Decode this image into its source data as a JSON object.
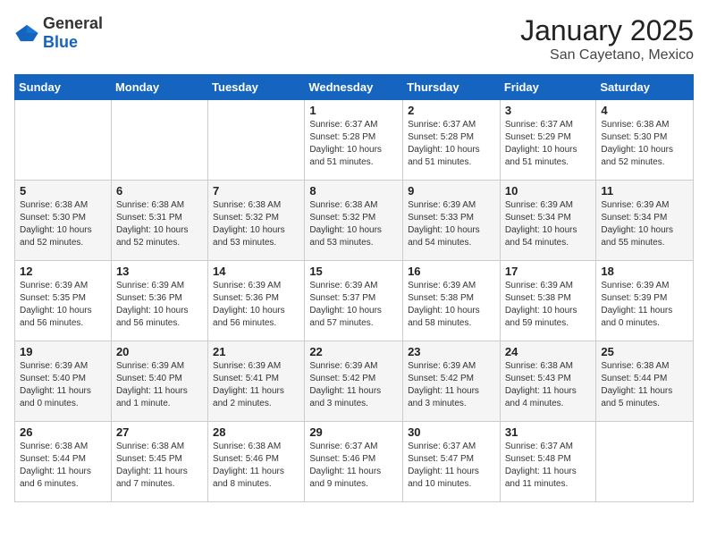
{
  "logo": {
    "general": "General",
    "blue": "Blue"
  },
  "header": {
    "month": "January 2025",
    "location": "San Cayetano, Mexico"
  },
  "weekdays": [
    "Sunday",
    "Monday",
    "Tuesday",
    "Wednesday",
    "Thursday",
    "Friday",
    "Saturday"
  ],
  "weeks": [
    [
      {
        "day": "",
        "info": ""
      },
      {
        "day": "",
        "info": ""
      },
      {
        "day": "",
        "info": ""
      },
      {
        "day": "1",
        "info": "Sunrise: 6:37 AM\nSunset: 5:28 PM\nDaylight: 10 hours\nand 51 minutes."
      },
      {
        "day": "2",
        "info": "Sunrise: 6:37 AM\nSunset: 5:28 PM\nDaylight: 10 hours\nand 51 minutes."
      },
      {
        "day": "3",
        "info": "Sunrise: 6:37 AM\nSunset: 5:29 PM\nDaylight: 10 hours\nand 51 minutes."
      },
      {
        "day": "4",
        "info": "Sunrise: 6:38 AM\nSunset: 5:30 PM\nDaylight: 10 hours\nand 52 minutes."
      }
    ],
    [
      {
        "day": "5",
        "info": "Sunrise: 6:38 AM\nSunset: 5:30 PM\nDaylight: 10 hours\nand 52 minutes."
      },
      {
        "day": "6",
        "info": "Sunrise: 6:38 AM\nSunset: 5:31 PM\nDaylight: 10 hours\nand 52 minutes."
      },
      {
        "day": "7",
        "info": "Sunrise: 6:38 AM\nSunset: 5:32 PM\nDaylight: 10 hours\nand 53 minutes."
      },
      {
        "day": "8",
        "info": "Sunrise: 6:38 AM\nSunset: 5:32 PM\nDaylight: 10 hours\nand 53 minutes."
      },
      {
        "day": "9",
        "info": "Sunrise: 6:39 AM\nSunset: 5:33 PM\nDaylight: 10 hours\nand 54 minutes."
      },
      {
        "day": "10",
        "info": "Sunrise: 6:39 AM\nSunset: 5:34 PM\nDaylight: 10 hours\nand 54 minutes."
      },
      {
        "day": "11",
        "info": "Sunrise: 6:39 AM\nSunset: 5:34 PM\nDaylight: 10 hours\nand 55 minutes."
      }
    ],
    [
      {
        "day": "12",
        "info": "Sunrise: 6:39 AM\nSunset: 5:35 PM\nDaylight: 10 hours\nand 56 minutes."
      },
      {
        "day": "13",
        "info": "Sunrise: 6:39 AM\nSunset: 5:36 PM\nDaylight: 10 hours\nand 56 minutes."
      },
      {
        "day": "14",
        "info": "Sunrise: 6:39 AM\nSunset: 5:36 PM\nDaylight: 10 hours\nand 56 minutes."
      },
      {
        "day": "15",
        "info": "Sunrise: 6:39 AM\nSunset: 5:37 PM\nDaylight: 10 hours\nand 57 minutes."
      },
      {
        "day": "16",
        "info": "Sunrise: 6:39 AM\nSunset: 5:38 PM\nDaylight: 10 hours\nand 58 minutes."
      },
      {
        "day": "17",
        "info": "Sunrise: 6:39 AM\nSunset: 5:38 PM\nDaylight: 10 hours\nand 59 minutes."
      },
      {
        "day": "18",
        "info": "Sunrise: 6:39 AM\nSunset: 5:39 PM\nDaylight: 11 hours\nand 0 minutes."
      }
    ],
    [
      {
        "day": "19",
        "info": "Sunrise: 6:39 AM\nSunset: 5:40 PM\nDaylight: 11 hours\nand 0 minutes."
      },
      {
        "day": "20",
        "info": "Sunrise: 6:39 AM\nSunset: 5:40 PM\nDaylight: 11 hours\nand 1 minute."
      },
      {
        "day": "21",
        "info": "Sunrise: 6:39 AM\nSunset: 5:41 PM\nDaylight: 11 hours\nand 2 minutes."
      },
      {
        "day": "22",
        "info": "Sunrise: 6:39 AM\nSunset: 5:42 PM\nDaylight: 11 hours\nand 3 minutes."
      },
      {
        "day": "23",
        "info": "Sunrise: 6:39 AM\nSunset: 5:42 PM\nDaylight: 11 hours\nand 3 minutes."
      },
      {
        "day": "24",
        "info": "Sunrise: 6:38 AM\nSunset: 5:43 PM\nDaylight: 11 hours\nand 4 minutes."
      },
      {
        "day": "25",
        "info": "Sunrise: 6:38 AM\nSunset: 5:44 PM\nDaylight: 11 hours\nand 5 minutes."
      }
    ],
    [
      {
        "day": "26",
        "info": "Sunrise: 6:38 AM\nSunset: 5:44 PM\nDaylight: 11 hours\nand 6 minutes."
      },
      {
        "day": "27",
        "info": "Sunrise: 6:38 AM\nSunset: 5:45 PM\nDaylight: 11 hours\nand 7 minutes."
      },
      {
        "day": "28",
        "info": "Sunrise: 6:38 AM\nSunset: 5:46 PM\nDaylight: 11 hours\nand 8 minutes."
      },
      {
        "day": "29",
        "info": "Sunrise: 6:37 AM\nSunset: 5:46 PM\nDaylight: 11 hours\nand 9 minutes."
      },
      {
        "day": "30",
        "info": "Sunrise: 6:37 AM\nSunset: 5:47 PM\nDaylight: 11 hours\nand 10 minutes."
      },
      {
        "day": "31",
        "info": "Sunrise: 6:37 AM\nSunset: 5:48 PM\nDaylight: 11 hours\nand 11 minutes."
      },
      {
        "day": "",
        "info": ""
      }
    ]
  ]
}
